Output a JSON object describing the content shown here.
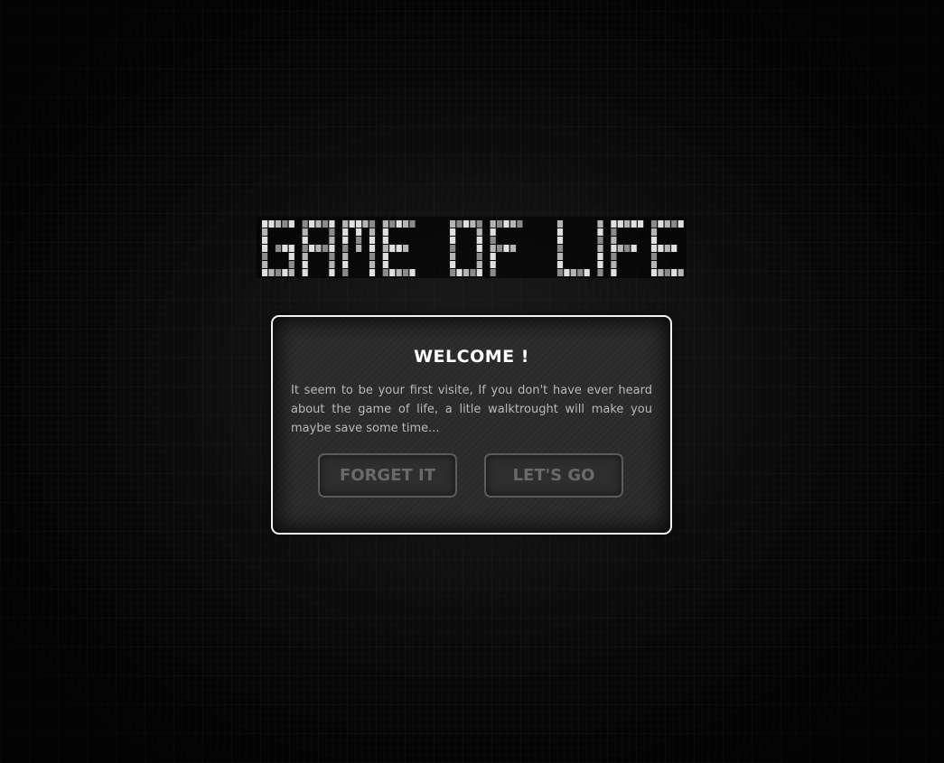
{
  "title": "GAME OF LIFE",
  "dialog": {
    "title": "WELCOME !",
    "body": "It seem to be your first visite, If you don't have ever heard about the game of life, a litle walktrought will make you maybe save some time...",
    "buttons": {
      "forget": "FORGET IT",
      "go": "LET'S GO"
    }
  },
  "colors": {
    "background": "#0a0a0a",
    "dialog_bg": "#2a2a2a",
    "dialog_border": "#f2f2f2",
    "button_border": "#5b5b5b",
    "button_text": "#6a6a6a",
    "logo_light": "#e0e0e0",
    "logo_dark": "#8a8a8a"
  }
}
